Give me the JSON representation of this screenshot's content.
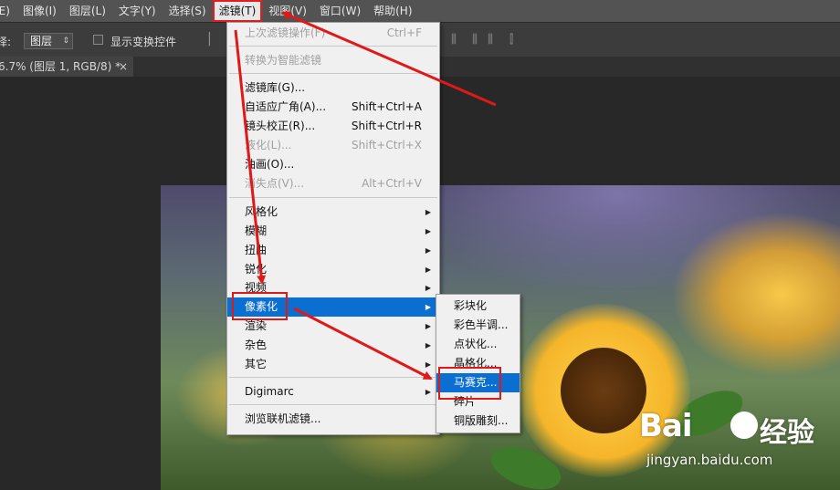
{
  "menubar": {
    "items": [
      {
        "label": "(E)"
      },
      {
        "label": "图像(I)"
      },
      {
        "label": "图层(L)"
      },
      {
        "label": "文字(Y)"
      },
      {
        "label": "选择(S)"
      },
      {
        "label": "滤镜(T)",
        "active": true
      },
      {
        "label": "视图(V)"
      },
      {
        "label": "窗口(W)"
      },
      {
        "label": "帮助(H)"
      }
    ]
  },
  "options": {
    "select_label": "择:",
    "layer_select": "图层",
    "transform_controls": "显示变换控件"
  },
  "document_tab": {
    "title": "6.7% (图层 1, RGB/8) *",
    "close": "×"
  },
  "filter_menu": {
    "items": [
      {
        "label": "上次滤镜操作(F)",
        "shortcut": "Ctrl+F",
        "disabled": true
      },
      {
        "label": "转换为智能滤镜",
        "disabled": true
      },
      {
        "label": "滤镜库(G)..."
      },
      {
        "label": "自适应广角(A)...",
        "shortcut": "Shift+Ctrl+A"
      },
      {
        "label": "镜头校正(R)...",
        "shortcut": "Shift+Ctrl+R"
      },
      {
        "label": "液化(L)...",
        "shortcut": "Shift+Ctrl+X",
        "disabled": true
      },
      {
        "label": "油画(O)..."
      },
      {
        "label": "消失点(V)...",
        "shortcut": "Alt+Ctrl+V",
        "disabled": true
      },
      {
        "label": "风格化",
        "submenu": true
      },
      {
        "label": "模糊",
        "submenu": true
      },
      {
        "label": "扭曲",
        "submenu": true
      },
      {
        "label": "锐化",
        "submenu": true
      },
      {
        "label": "视频",
        "submenu": true
      },
      {
        "label": "像素化",
        "submenu": true,
        "highlight": true
      },
      {
        "label": "渲染",
        "submenu": true
      },
      {
        "label": "杂色",
        "submenu": true
      },
      {
        "label": "其它",
        "submenu": true
      },
      {
        "label": "Digimarc",
        "submenu": true
      },
      {
        "label": "浏览联机滤镜..."
      }
    ]
  },
  "pixelate_submenu": {
    "items": [
      {
        "label": "彩块化"
      },
      {
        "label": "彩色半调..."
      },
      {
        "label": "点状化..."
      },
      {
        "label": "晶格化..."
      },
      {
        "label": "马赛克...",
        "highlight": true
      },
      {
        "label": "碎片"
      },
      {
        "label": "铜版雕刻..."
      }
    ]
  },
  "watermark": {
    "logo": "Bai",
    "brand": "经验",
    "url": "jingyan.baidu.com"
  },
  "colors": {
    "highlight": "#0a6fd1",
    "annotation_red": "#e01818",
    "menubar_bg": "#535353",
    "menu_bg": "#f0f0f0"
  }
}
